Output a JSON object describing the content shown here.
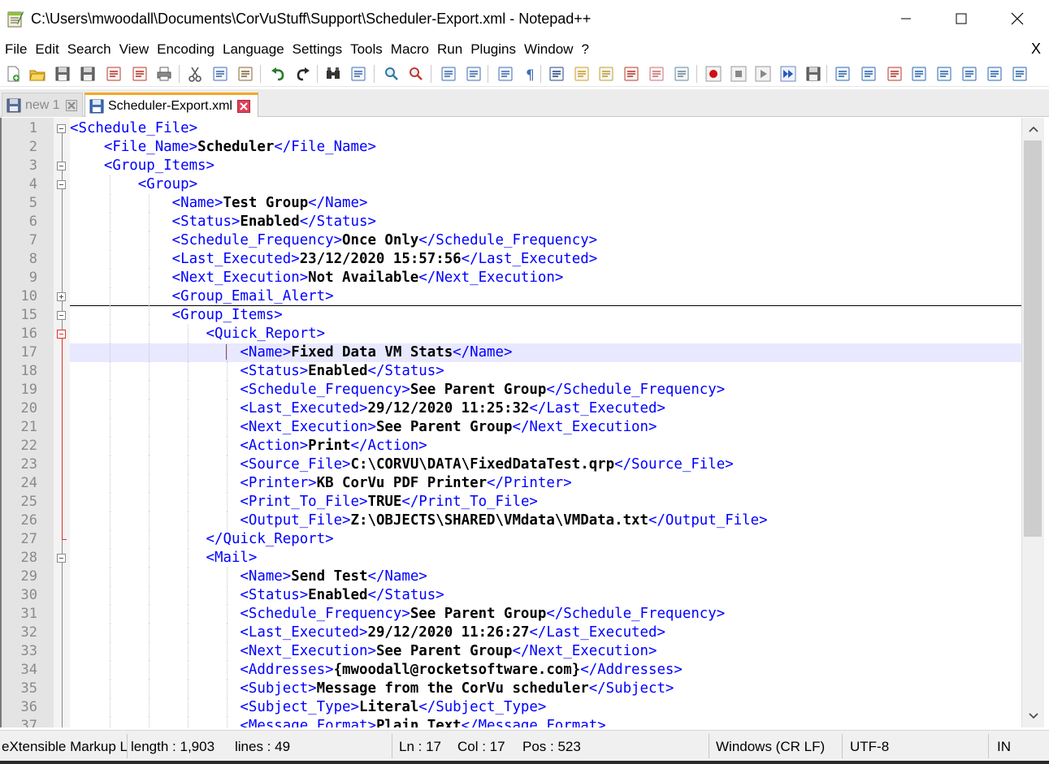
{
  "window": {
    "title": "C:\\Users\\mwoodall\\Documents\\CorVuStuff\\Support\\Scheduler-Export.xml - Notepad++",
    "minimize_icon": "minimize-icon",
    "maximize_icon": "maximize-icon",
    "close_icon": "close-icon"
  },
  "menu": {
    "items": [
      "File",
      "Edit",
      "Search",
      "View",
      "Encoding",
      "Language",
      "Settings",
      "Tools",
      "Macro",
      "Run",
      "Plugins",
      "Window",
      "?"
    ],
    "close_doc": "X"
  },
  "toolbar": {
    "icons": [
      "new-file-icon",
      "open-file-icon",
      "save-icon",
      "save-all-icon",
      "close-icon",
      "close-all-icon",
      "print-icon",
      "cut-icon",
      "copy-icon",
      "paste-icon",
      "undo-icon",
      "redo-icon",
      "find-icon",
      "replace-icon",
      "zoom-in-icon",
      "zoom-out-icon",
      "sync-vertical-icon",
      "sync-horizontal-icon",
      "word-wrap-icon",
      "show-all-chars-icon",
      "indent-guide-icon",
      "user-language-icon",
      "document-map-icon",
      "function-list-icon",
      "folder-workspace-icon",
      "monitoring-icon",
      "record-macro-icon",
      "stop-macro-icon",
      "play-macro-icon",
      "run-macro-multiple-icon",
      "save-macro-icon",
      "plugin-1-icon",
      "plugin-2-icon",
      "plugin-3-icon",
      "plugin-4-icon",
      "plugin-5-icon",
      "plugin-6-icon",
      "plugin-7-icon",
      "plugin-8-icon"
    ]
  },
  "tabs": [
    {
      "label": "new 1",
      "active": false
    },
    {
      "label": "Scheduler-Export.xml",
      "active": true
    }
  ],
  "editor": {
    "current_line": 17,
    "lines": [
      {
        "num": "1",
        "indent": "",
        "parts": [
          [
            "t",
            "<Schedule_File>"
          ]
        ]
      },
      {
        "num": "2",
        "indent": "    ",
        "parts": [
          [
            "t",
            "<File_Name>"
          ],
          [
            "v",
            "Scheduler"
          ],
          [
            "t",
            "</File_Name>"
          ]
        ]
      },
      {
        "num": "3",
        "indent": "    ",
        "parts": [
          [
            "t",
            "<Group_Items>"
          ]
        ]
      },
      {
        "num": "4",
        "indent": "        ",
        "parts": [
          [
            "t",
            "<Group>"
          ]
        ]
      },
      {
        "num": "5",
        "indent": "            ",
        "parts": [
          [
            "t",
            "<Name>"
          ],
          [
            "v",
            "Test Group"
          ],
          [
            "t",
            "</Name>"
          ]
        ]
      },
      {
        "num": "6",
        "indent": "            ",
        "parts": [
          [
            "t",
            "<Status>"
          ],
          [
            "v",
            "Enabled"
          ],
          [
            "t",
            "</Status>"
          ]
        ]
      },
      {
        "num": "7",
        "indent": "            ",
        "parts": [
          [
            "t",
            "<Schedule_Frequency>"
          ],
          [
            "v",
            "Once Only"
          ],
          [
            "t",
            "</Schedule_Frequency>"
          ]
        ]
      },
      {
        "num": "8",
        "indent": "            ",
        "parts": [
          [
            "t",
            "<Last_Executed>"
          ],
          [
            "v",
            "23/12/2020 15:57:56"
          ],
          [
            "t",
            "</Last_Executed>"
          ]
        ]
      },
      {
        "num": "9",
        "indent": "            ",
        "parts": [
          [
            "t",
            "<Next_Execution>"
          ],
          [
            "v",
            "Not Available"
          ],
          [
            "t",
            "</Next_Execution>"
          ]
        ]
      },
      {
        "num": "10",
        "indent": "            ",
        "parts": [
          [
            "t",
            "<Group_Email_Alert>"
          ]
        ]
      },
      {
        "num": "15",
        "indent": "            ",
        "parts": [
          [
            "t",
            "<Group_Items>"
          ]
        ]
      },
      {
        "num": "16",
        "indent": "                ",
        "parts": [
          [
            "t",
            "<Quick_Report>"
          ]
        ]
      },
      {
        "num": "17",
        "indent": "                    ",
        "parts": [
          [
            "t",
            "<Name>"
          ],
          [
            "v",
            "Fixed Data VM Stats"
          ],
          [
            "t",
            "</Name>"
          ]
        ]
      },
      {
        "num": "18",
        "indent": "                    ",
        "parts": [
          [
            "t",
            "<Status>"
          ],
          [
            "v",
            "Enabled"
          ],
          [
            "t",
            "</Status>"
          ]
        ]
      },
      {
        "num": "19",
        "indent": "                    ",
        "parts": [
          [
            "t",
            "<Schedule_Frequency>"
          ],
          [
            "v",
            "See Parent Group"
          ],
          [
            "t",
            "</Schedule_Frequency>"
          ]
        ]
      },
      {
        "num": "20",
        "indent": "                    ",
        "parts": [
          [
            "t",
            "<Last_Executed>"
          ],
          [
            "v",
            "29/12/2020 11:25:32"
          ],
          [
            "t",
            "</Last_Executed>"
          ]
        ]
      },
      {
        "num": "21",
        "indent": "                    ",
        "parts": [
          [
            "t",
            "<Next_Execution>"
          ],
          [
            "v",
            "See Parent Group"
          ],
          [
            "t",
            "</Next_Execution>"
          ]
        ]
      },
      {
        "num": "22",
        "indent": "                    ",
        "parts": [
          [
            "t",
            "<Action>"
          ],
          [
            "v",
            "Print"
          ],
          [
            "t",
            "</Action>"
          ]
        ]
      },
      {
        "num": "23",
        "indent": "                    ",
        "parts": [
          [
            "t",
            "<Source_File>"
          ],
          [
            "v",
            "C:\\CORVU\\DATA\\FixedDataTest.qrp"
          ],
          [
            "t",
            "</Source_File>"
          ]
        ]
      },
      {
        "num": "24",
        "indent": "                    ",
        "parts": [
          [
            "t",
            "<Printer>"
          ],
          [
            "v",
            "KB CorVu PDF Printer"
          ],
          [
            "t",
            "</Printer>"
          ]
        ]
      },
      {
        "num": "25",
        "indent": "                    ",
        "parts": [
          [
            "t",
            "<Print_To_File>"
          ],
          [
            "v",
            "TRUE"
          ],
          [
            "t",
            "</Print_To_File>"
          ]
        ]
      },
      {
        "num": "26",
        "indent": "                    ",
        "parts": [
          [
            "t",
            "<Output_File>"
          ],
          [
            "v",
            "Z:\\OBJECTS\\SHARED\\VMdata\\VMData.txt"
          ],
          [
            "t",
            "</Output_File>"
          ]
        ]
      },
      {
        "num": "27",
        "indent": "                ",
        "parts": [
          [
            "t",
            "</Quick_Report>"
          ]
        ]
      },
      {
        "num": "28",
        "indent": "                ",
        "parts": [
          [
            "t",
            "<Mail>"
          ]
        ]
      },
      {
        "num": "29",
        "indent": "                    ",
        "parts": [
          [
            "t",
            "<Name>"
          ],
          [
            "v",
            "Send Test"
          ],
          [
            "t",
            "</Name>"
          ]
        ]
      },
      {
        "num": "30",
        "indent": "                    ",
        "parts": [
          [
            "t",
            "<Status>"
          ],
          [
            "v",
            "Enabled"
          ],
          [
            "t",
            "</Status>"
          ]
        ]
      },
      {
        "num": "31",
        "indent": "                    ",
        "parts": [
          [
            "t",
            "<Schedule_Frequency>"
          ],
          [
            "v",
            "See Parent Group"
          ],
          [
            "t",
            "</Schedule_Frequency>"
          ]
        ]
      },
      {
        "num": "32",
        "indent": "                    ",
        "parts": [
          [
            "t",
            "<Last_Executed>"
          ],
          [
            "v",
            "29/12/2020 11:26:27"
          ],
          [
            "t",
            "</Last_Executed>"
          ]
        ]
      },
      {
        "num": "33",
        "indent": "                    ",
        "parts": [
          [
            "t",
            "<Next_Execution>"
          ],
          [
            "v",
            "See Parent Group"
          ],
          [
            "t",
            "</Next_Execution>"
          ]
        ]
      },
      {
        "num": "34",
        "indent": "                    ",
        "parts": [
          [
            "t",
            "<Addresses>"
          ],
          [
            "v",
            "{mwoodall@rocketsoftware.com}"
          ],
          [
            "t",
            "</Addresses>"
          ]
        ]
      },
      {
        "num": "35",
        "indent": "                    ",
        "parts": [
          [
            "t",
            "<Subject>"
          ],
          [
            "v",
            "Message from the CorVu scheduler"
          ],
          [
            "t",
            "</Subject>"
          ]
        ]
      },
      {
        "num": "36",
        "indent": "                    ",
        "parts": [
          [
            "t",
            "<Subject_Type>"
          ],
          [
            "v",
            "Literal"
          ],
          [
            "t",
            "</Subject_Type>"
          ]
        ]
      },
      {
        "num": "37",
        "indent": "                    ",
        "parts": [
          [
            "t",
            "<Message_Format>"
          ],
          [
            "v",
            "Plain Text"
          ],
          [
            "t",
            "</Message_Format>"
          ]
        ]
      }
    ],
    "folds": [
      {
        "line": "1",
        "type": "minus"
      },
      {
        "line": "3",
        "type": "minus"
      },
      {
        "line": "4",
        "type": "minus"
      },
      {
        "line": "10",
        "type": "plus"
      },
      {
        "line": "15",
        "type": "minus"
      },
      {
        "line": "16",
        "type": "minus-red"
      },
      {
        "line": "28",
        "type": "minus"
      }
    ]
  },
  "status": {
    "language": "eXtensible Markup Language file",
    "length": "length : 1,903",
    "lines": "lines : 49",
    "ln": "Ln : 17",
    "col": "Col : 17",
    "pos": "Pos : 523",
    "eol": "Windows (CR LF)",
    "encoding": "UTF-8",
    "mode": "IN"
  },
  "colors": {
    "tag": "#0000ff",
    "text": "#000000",
    "current_line": "#e8e8ff",
    "fold_active": "#e0302a"
  }
}
